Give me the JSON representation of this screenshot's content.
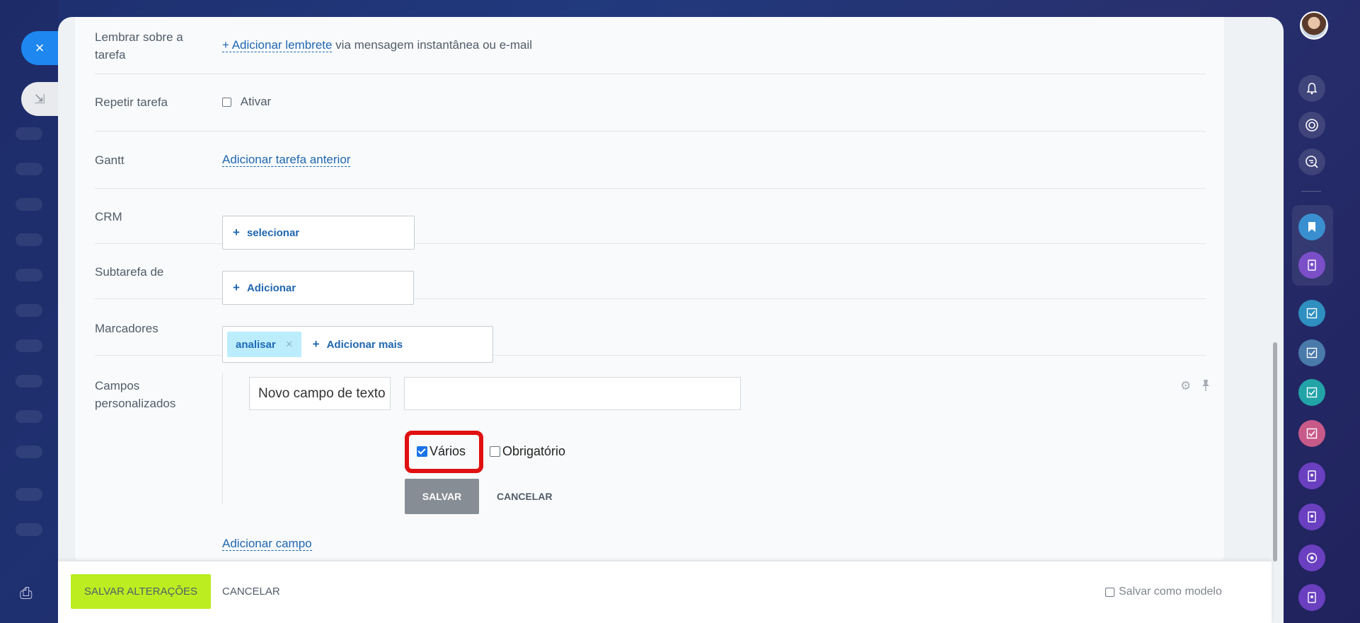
{
  "rows": {
    "reminder": {
      "label_line1": "Lembrar sobre a",
      "label_line2": "tarefa",
      "link": "+ Adicionar lembrete",
      "suffix": " via mensagem instantânea ou e-mail"
    },
    "repeat": {
      "label": "Repetir tarefa",
      "checkbox_label": "Ativar"
    },
    "gantt": {
      "label": "Gantt",
      "link": "Adicionar tarefa anterior"
    },
    "crm": {
      "label": "CRM",
      "button": "selecionar"
    },
    "subtask": {
      "label": "Subtarefa de",
      "button": "Adicionar"
    },
    "tags": {
      "label": "Marcadores",
      "tag": "analisar",
      "tag_remove": "×",
      "add_more": "Adicionar mais"
    },
    "custom_fields": {
      "label_line1": "Campos",
      "label_line2": "personalizados",
      "name_value": "Novo campo de texto",
      "value_placeholder": "",
      "multiple_label": "Vários",
      "multiple_checked": true,
      "required_label": "Obrigatório",
      "required_checked": false,
      "save": "SALVAR",
      "cancel": "CANCELAR",
      "add_field": "Adicionar campo"
    }
  },
  "plus_sign": "+",
  "footer": {
    "save": "SALVAR ALTERAÇÕES",
    "cancel": "CANCELAR",
    "template_label": "Salvar como modelo"
  },
  "icons": {
    "close": "×",
    "minimize": "⇲",
    "print": "⎙",
    "gear": "⚙",
    "pin": "📌"
  },
  "colors": {
    "accent": "#2067b0",
    "save_green": "#bbed21",
    "highlight": "#e01010"
  }
}
